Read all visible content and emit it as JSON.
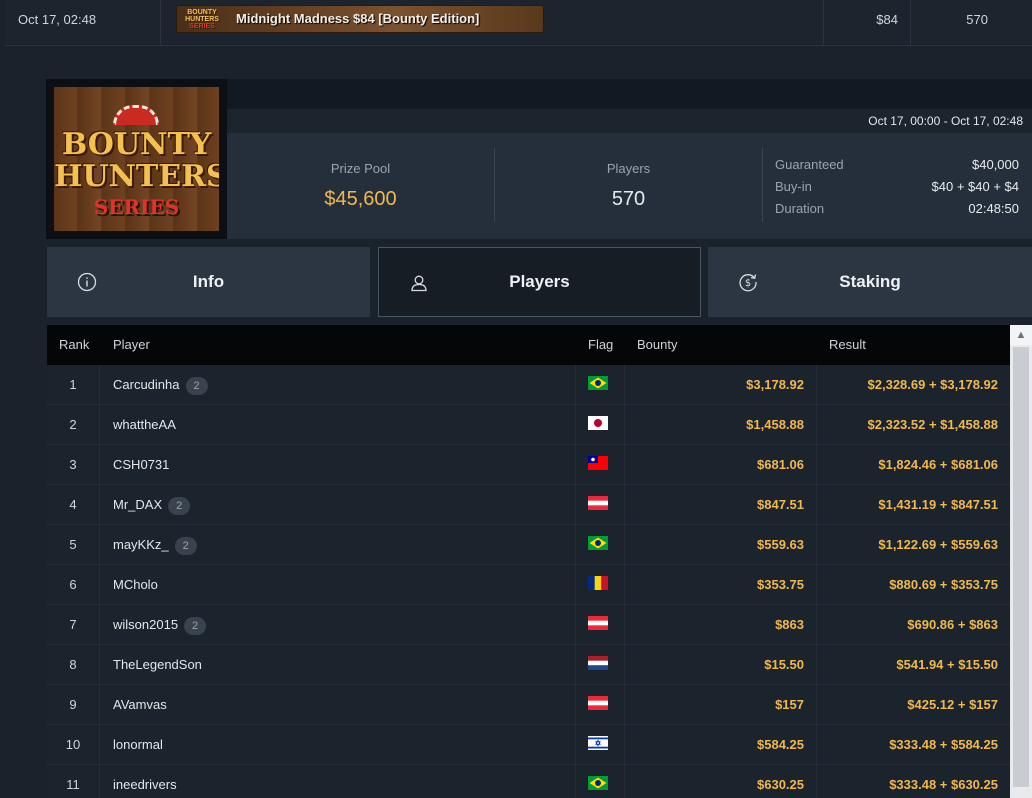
{
  "top_row": {
    "datetime": "Oct 17, 02:48",
    "banner_title": "Midnight Madness $84 [Bounty Edition]",
    "banner_logo_text": [
      "BOUNTY",
      "HUNTERS",
      "SERIES"
    ],
    "buyin": "$84",
    "entries": "570"
  },
  "tournament": {
    "logo_text": [
      "BOUNTY",
      "HUNTERS",
      "SERIES"
    ],
    "date_range": "Oct 17, 00:00 - Oct 17, 02:48",
    "prize_pool_label": "Prize Pool",
    "prize_pool_value": "$45,600",
    "players_label": "Players",
    "players_value": "570",
    "details": [
      {
        "key": "Guaranteed",
        "value": "$40,000"
      },
      {
        "key": "Buy-in",
        "value": "$40 + $40 + $4"
      },
      {
        "key": "Duration",
        "value": "02:48:50"
      }
    ]
  },
  "tabs": [
    {
      "label": "Info",
      "icon": "info-icon",
      "active": false
    },
    {
      "label": "Players",
      "icon": "user-icon",
      "active": true
    },
    {
      "label": "Staking",
      "icon": "dollar-cycle-icon",
      "active": false
    }
  ],
  "table": {
    "headers": {
      "rank": "Rank",
      "player": "Player",
      "flag": "Flag",
      "bounty": "Bounty",
      "result": "Result"
    },
    "rows": [
      {
        "rank": "1",
        "player": "Carcudinha",
        "badge": "2",
        "flag": "brazil",
        "bounty": "$3,178.92",
        "result": "$2,328.69 + $3,178.92"
      },
      {
        "rank": "2",
        "player": "whattheAA",
        "badge": "",
        "flag": "japan",
        "bounty": "$1,458.88",
        "result": "$2,323.52 + $1,458.88"
      },
      {
        "rank": "3",
        "player": "CSH0731",
        "badge": "",
        "flag": "taiwan",
        "bounty": "$681.06",
        "result": "$1,824.46 + $681.06"
      },
      {
        "rank": "4",
        "player": "Mr_DAX",
        "badge": "2",
        "flag": "austria",
        "bounty": "$847.51",
        "result": "$1,431.19 + $847.51"
      },
      {
        "rank": "5",
        "player": "mayKKz_",
        "badge": "2",
        "flag": "brazil",
        "bounty": "$559.63",
        "result": "$1,122.69 + $559.63"
      },
      {
        "rank": "6",
        "player": "MCholo",
        "badge": "",
        "flag": "romania",
        "bounty": "$353.75",
        "result": "$880.69 + $353.75"
      },
      {
        "rank": "7",
        "player": "wilson2015",
        "badge": "2",
        "flag": "austria",
        "bounty": "$863",
        "result": "$690.86 + $863"
      },
      {
        "rank": "8",
        "player": "TheLegendSon",
        "badge": "",
        "flag": "netherlands",
        "bounty": "$15.50",
        "result": "$541.94 + $15.50"
      },
      {
        "rank": "9",
        "player": "AVamvas",
        "badge": "",
        "flag": "austria",
        "bounty": "$157",
        "result": "$425.12 + $157"
      },
      {
        "rank": "10",
        "player": "lonormal",
        "badge": "",
        "flag": "israel",
        "bounty": "$584.25",
        "result": "$333.48 + $584.25"
      },
      {
        "rank": "11",
        "player": "ineedrivers",
        "badge": "",
        "flag": "brazil",
        "bounty": "$630.25",
        "result": "$333.48 + $630.25"
      }
    ]
  },
  "colors": {
    "accent_gold": "#f0b84e",
    "background": "#1a222c",
    "panel": "#252f3b"
  }
}
